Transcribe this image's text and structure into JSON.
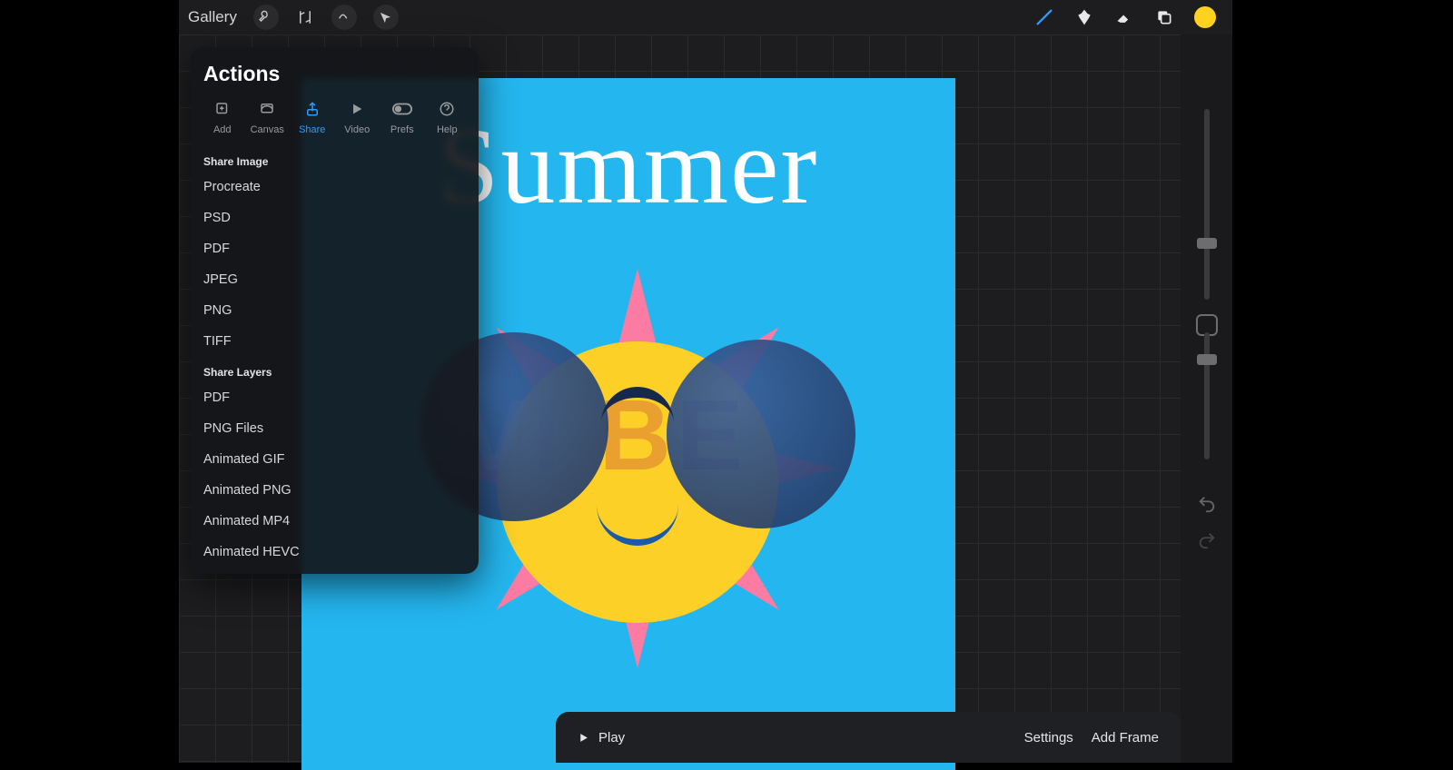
{
  "topbar": {
    "gallery_label": "Gallery"
  },
  "actions": {
    "title": "Actions",
    "tabs": {
      "add": "Add",
      "canvas": "Canvas",
      "share": "Share",
      "video": "Video",
      "prefs": "Prefs",
      "help": "Help"
    },
    "share_image_label": "Share Image",
    "share_layers_label": "Share Layers",
    "image_formats": [
      "Procreate",
      "PSD",
      "PDF",
      "JPEG",
      "PNG",
      "TIFF"
    ],
    "layer_formats": [
      "PDF",
      "PNG Files",
      "Animated GIF",
      "Animated PNG",
      "Animated MP4",
      "Animated HEVC"
    ]
  },
  "artwork": {
    "title_word": "Summer",
    "overlay_word": {
      "v": "V",
      "i": "I",
      "b": "B",
      "e": "E"
    }
  },
  "anim": {
    "play": "Play",
    "settings": "Settings",
    "add_frame": "Add Frame"
  },
  "colors": {
    "swatch": "#ffd21f",
    "accent": "#2f9aff"
  }
}
